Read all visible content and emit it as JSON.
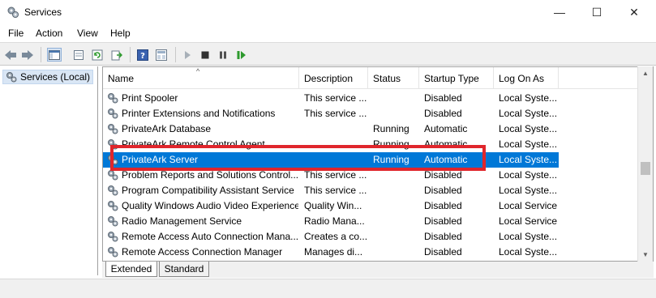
{
  "window": {
    "title": "Services",
    "app_icon": "services-gear-icon",
    "controls": {
      "minimize": "—",
      "maximize": "☐",
      "close": "✕"
    }
  },
  "menu": [
    "File",
    "Action",
    "View",
    "Help"
  ],
  "toolbar": {
    "buttons": [
      "back-arrow-icon",
      "forward-arrow-icon",
      "show-hide-console-tree-icon",
      "properties-icon",
      "refresh-icon",
      "export-list-icon",
      "help-icon",
      "console-view-icon",
      "start-service-icon",
      "stop-service-icon",
      "pause-service-icon",
      "restart-service-icon"
    ]
  },
  "tree": {
    "selected_label": "Services (Local)"
  },
  "table": {
    "columns": [
      "Name",
      "Description",
      "Status",
      "Startup Type",
      "Log On As"
    ],
    "sort_indicator": "^",
    "rows": [
      {
        "name": "Print Spooler",
        "description": "This service ...",
        "status": "",
        "startup": "Disabled",
        "logon": "Local Syste..."
      },
      {
        "name": "Printer Extensions and Notifications",
        "description": "This service ...",
        "status": "",
        "startup": "Disabled",
        "logon": "Local Syste..."
      },
      {
        "name": "PrivateArk Database",
        "description": "",
        "status": "Running",
        "startup": "Automatic",
        "logon": "Local Syste..."
      },
      {
        "name": "PrivateArk Remote Control Agent",
        "description": "",
        "status": "Running",
        "startup": "Automatic",
        "logon": "Local Syste..."
      },
      {
        "name": "PrivateArk Server",
        "description": "",
        "status": "Running",
        "startup": "Automatic",
        "logon": "Local Syste..."
      },
      {
        "name": "Problem Reports and Solutions Control...",
        "description": "This service ...",
        "status": "",
        "startup": "Disabled",
        "logon": "Local Syste..."
      },
      {
        "name": "Program Compatibility Assistant Service",
        "description": "This service ...",
        "status": "",
        "startup": "Disabled",
        "logon": "Local Syste..."
      },
      {
        "name": "Quality Windows Audio Video Experience",
        "description": "Quality Win...",
        "status": "",
        "startup": "Disabled",
        "logon": "Local Service"
      },
      {
        "name": "Radio Management Service",
        "description": "Radio Mana...",
        "status": "",
        "startup": "Disabled",
        "logon": "Local Service"
      },
      {
        "name": "Remote Access Auto Connection Mana...",
        "description": "Creates a co...",
        "status": "",
        "startup": "Disabled",
        "logon": "Local Syste..."
      },
      {
        "name": "Remote Access Connection Manager",
        "description": "Manages di...",
        "status": "",
        "startup": "Disabled",
        "logon": "Local Syste..."
      }
    ],
    "selected_row_index": 4
  },
  "tabs": [
    "Extended",
    "Standard"
  ],
  "colors": {
    "selection": "#0078d7",
    "highlight_box": "#e0262c"
  }
}
